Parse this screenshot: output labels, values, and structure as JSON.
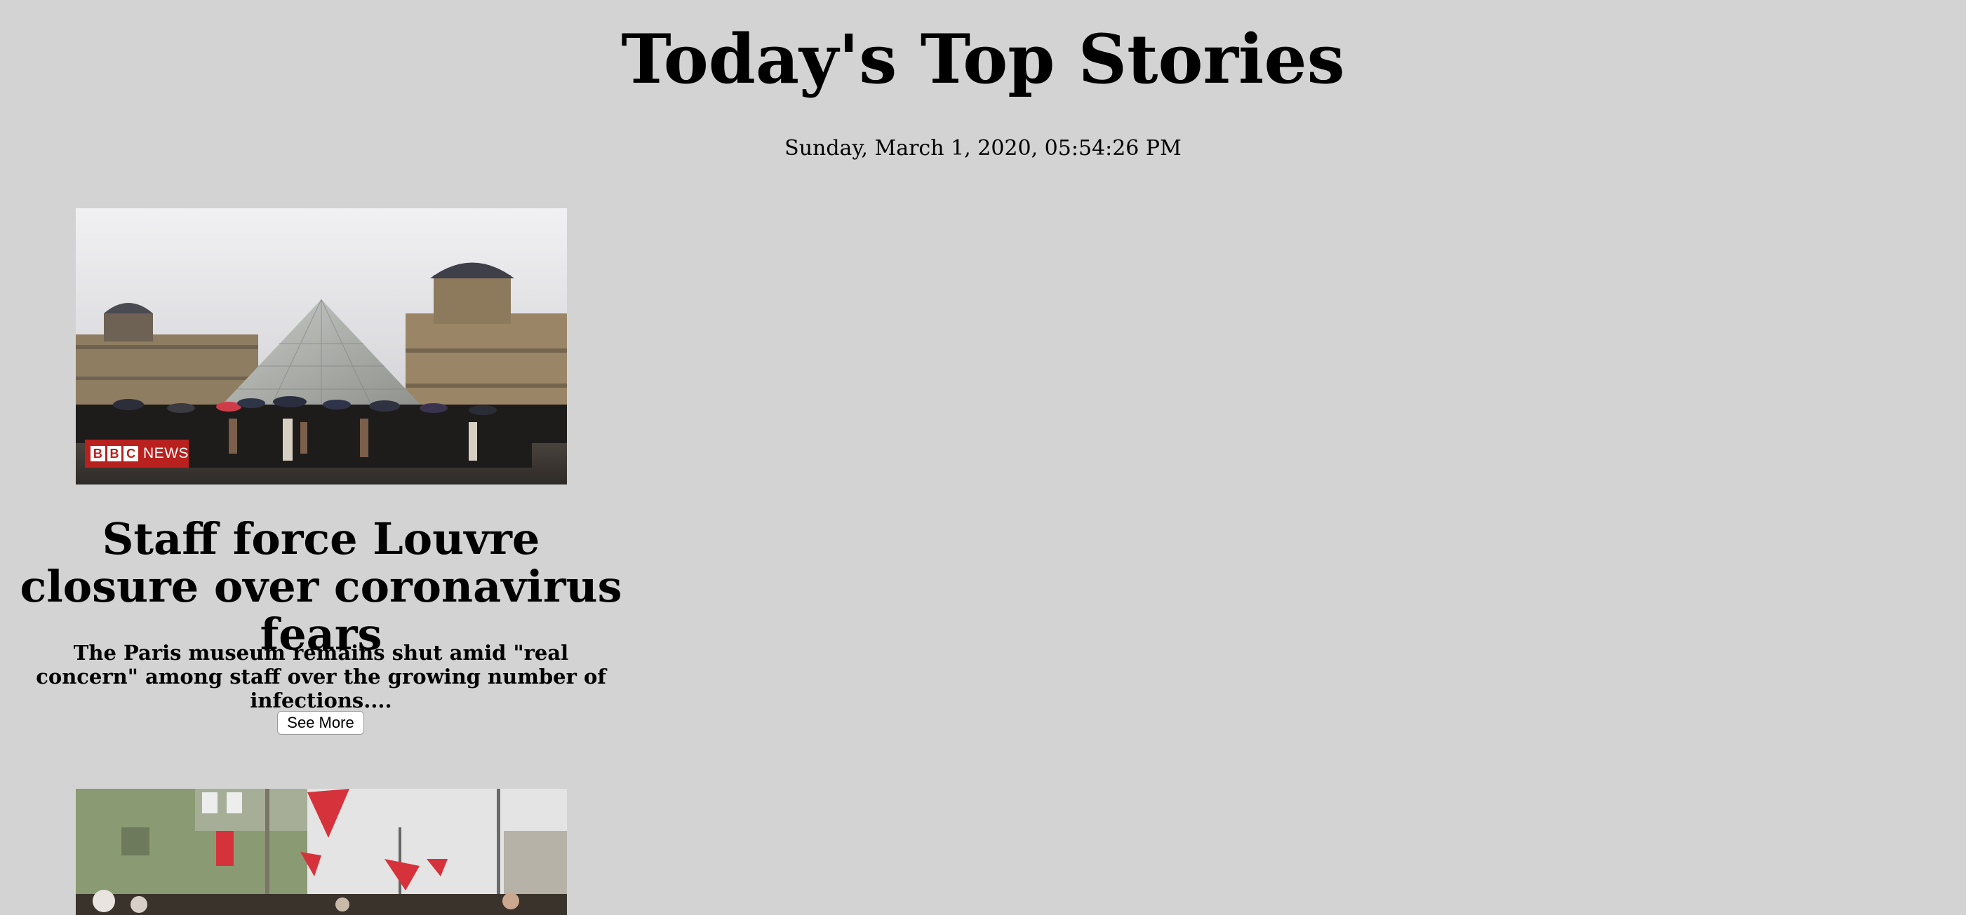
{
  "header": {
    "title": "Today's Top Stories",
    "datetime": "Sunday, March 1, 2020, 05:54:26 PM"
  },
  "stories": [
    {
      "image_badge": {
        "letters": [
          "B",
          "B",
          "C"
        ],
        "label": "NEWS"
      },
      "headline": "Staff force Louvre closure over coronavirus fears",
      "summary": "The Paris museum remains shut amid \"real concern\" among staff over the growing number of infections....",
      "button_label": "See More"
    },
    {
      "image_badge": null
    }
  ],
  "colors": {
    "background": "#d3d3d3",
    "bbc_red": "#b8211d",
    "button_bg": "#ffffff"
  }
}
